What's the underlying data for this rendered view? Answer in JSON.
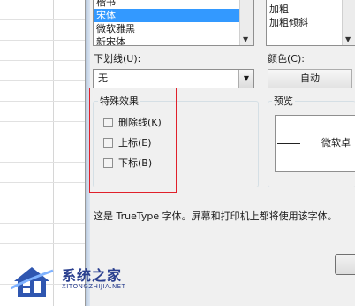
{
  "font_list": {
    "items": [
      "楷书",
      "宋体",
      "微软雅黑",
      "新宋体"
    ],
    "selected_index": 1
  },
  "style_list": {
    "items": [
      "加粗",
      "加粗倾斜"
    ]
  },
  "underline": {
    "label": "下划线(U):",
    "value": "无"
  },
  "color": {
    "label": "颜色(C):",
    "value": "自动"
  },
  "effects": {
    "title": "特殊效果",
    "options": [
      {
        "label": "删除线(K)",
        "checked": false
      },
      {
        "label": "上标(E)",
        "checked": false
      },
      {
        "label": "下标(B)",
        "checked": false
      }
    ]
  },
  "preview": {
    "title": "预览",
    "sample_text": "微软卓"
  },
  "info_text": "这是 TrueType 字体。屏幕和打印机上都将使用该字体。",
  "watermark": {
    "name": "系统之家",
    "url": "XITONGZHIJIA.NET"
  },
  "colors": {
    "selection": "#3399ff",
    "highlight_border": "#e0202a",
    "dialog_bg": "#f0f0f0"
  }
}
